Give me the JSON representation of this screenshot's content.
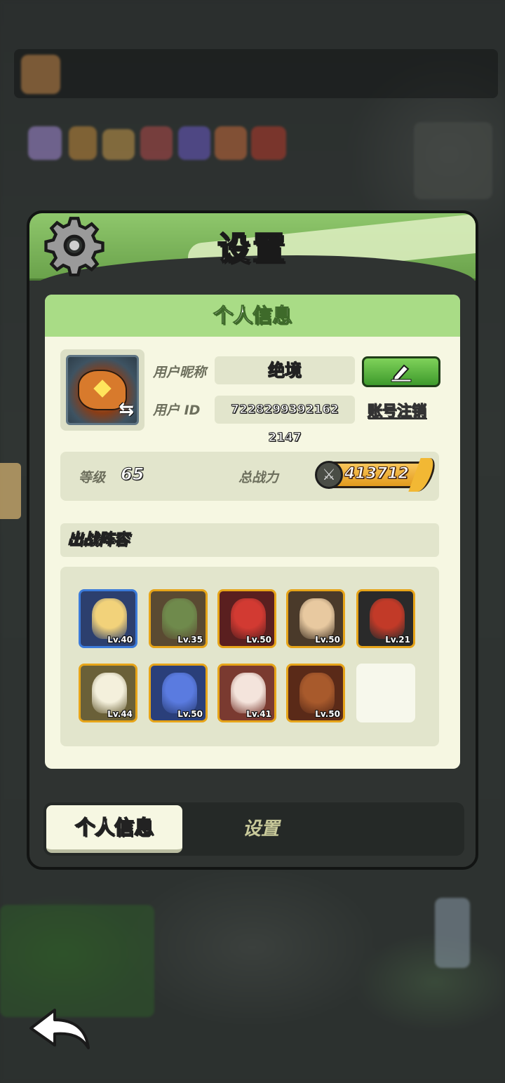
{
  "panel": {
    "title": "设置"
  },
  "profile": {
    "section_title": "个人信息",
    "nickname_label": "用户昵称",
    "nickname_value": "绝境",
    "id_label": "用户  ID",
    "id_value": "7228299392162​2147",
    "logout_label": "账号注销"
  },
  "stats": {
    "level_label": "等级",
    "level_value": "65",
    "power_label": "总战力",
    "power_value": "413712"
  },
  "lineup": {
    "title": "出战阵容",
    "heroes": [
      {
        "level": "Lv.40",
        "color": "#3b7ad9",
        "bg": "#2c3f6e",
        "face": "#f2d27a"
      },
      {
        "level": "Lv.35",
        "color": "#e6a419",
        "bg": "#5a4a32",
        "face": "#6f8a4c"
      },
      {
        "level": "Lv.50",
        "color": "#e6a419",
        "bg": "#5a1f1f",
        "face": "#d23a32"
      },
      {
        "level": "Lv.50",
        "color": "#e6a419",
        "bg": "#4a3a2a",
        "face": "#e8c9a0"
      },
      {
        "level": "Lv.21",
        "color": "#e6a419",
        "bg": "#2a2a2a",
        "face": "#c23a28"
      },
      {
        "level": "Lv.44",
        "color": "#e6a419",
        "bg": "#6a6038",
        "face": "#f4f0dc"
      },
      {
        "level": "Lv.50",
        "color": "#e6a419",
        "bg": "#2a3f7a",
        "face": "#5a7be0"
      },
      {
        "level": "Lv.41",
        "color": "#e6a419",
        "bg": "#7a3a30",
        "face": "#f4e4dc"
      },
      {
        "level": "Lv.50",
        "color": "#e6a419",
        "bg": "#5a2a18",
        "face": "#a85a2c"
      }
    ]
  },
  "tabs": {
    "active_label": "个人信息",
    "inactive_label": "设置"
  },
  "icons": {
    "gear": "gear-icon",
    "edit": "pencil-icon",
    "swap": "swap-icon",
    "power": "crossed-swords-icon",
    "back": "back-arrow-icon"
  }
}
